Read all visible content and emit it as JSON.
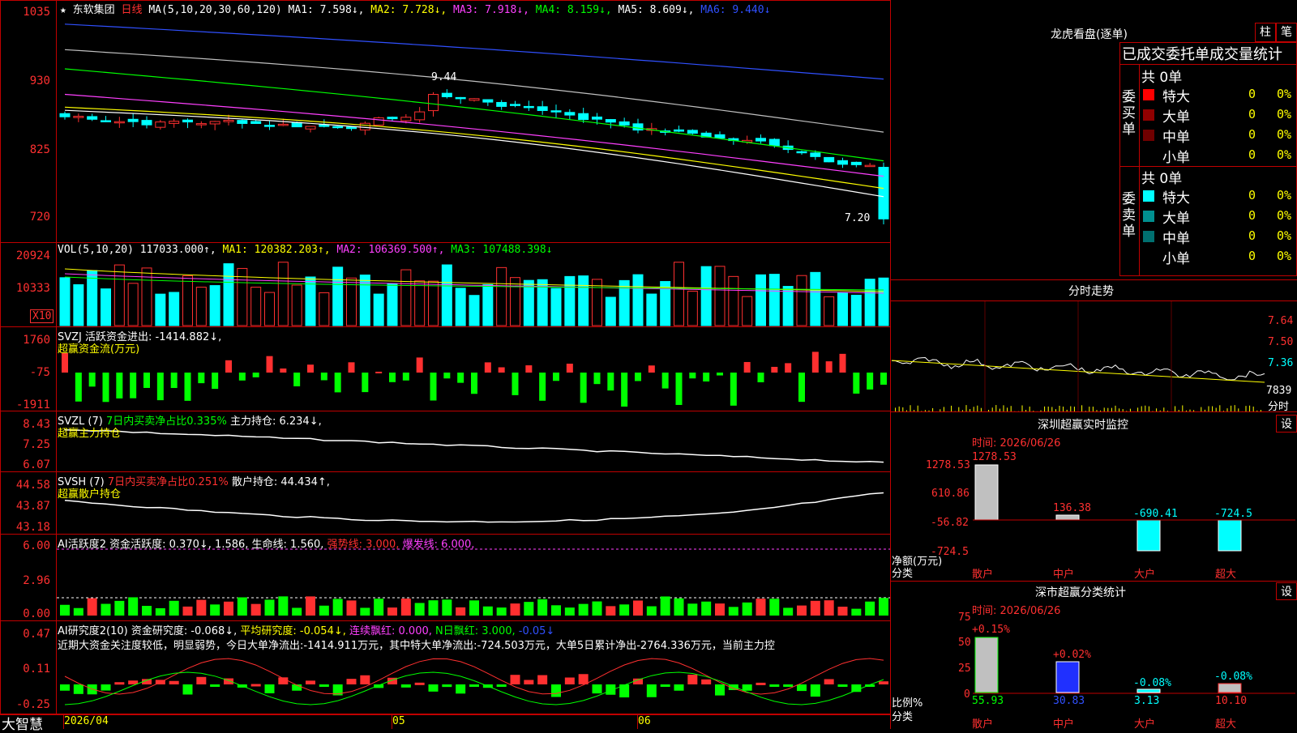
{
  "main_chart": {
    "star": "★",
    "stock_name": "东软集团",
    "period": "日线",
    "ma_header": "MA(5,10,20,30,60,120)",
    "ma1": "MA1: 7.598↓,",
    "ma2": "MA2: 7.728↓,",
    "ma3": "MA3: 7.918↓,",
    "ma4": "MA4: 8.159↓,",
    "ma5": "MA5: 8.609↓,",
    "ma6": "MA6: 9.440↓",
    "y_ticks": [
      "1035",
      "930",
      "825",
      "720"
    ],
    "high_label": "9.44",
    "low_label": "7.20"
  },
  "vol_chart": {
    "header": "VOL(5,10,20)",
    "vol": "117033.000↑,",
    "ma1": "MA1: 120382.203↑,",
    "ma2": "MA2: 106369.500↑,",
    "ma3": "MA3: 107488.398↓",
    "y_ticks": [
      "20924",
      "10333"
    ],
    "unit": "X10"
  },
  "svzj": {
    "header": "SVZJ  活跃资金进出: -1414.882↓,",
    "sub": "超赢资金流(万元)",
    "y_ticks": [
      "1760",
      "-75",
      "-1911"
    ]
  },
  "svzl": {
    "header_a": "SVZL (7)",
    "header_b": "7日内买卖净占比0.335%",
    "header_c": "主力持仓: 6.234↓,",
    "sub": "超赢主力持仓",
    "y_ticks": [
      "8.43",
      "7.25",
      "6.07"
    ]
  },
  "svsh": {
    "header_a": "SVSH (7)",
    "header_b": "7日内买卖净占比0.251%",
    "header_c": "散户持仓: 44.434↑,",
    "sub": "超赢散户持仓",
    "y_ticks": [
      "44.58",
      "43.87",
      "43.18"
    ]
  },
  "ai_active": {
    "header_a": "AI活跃度2",
    "header_b": "资金活跃度: 0.370↓,",
    "header_c": "1.586,",
    "header_d": "生命线: 1.560,",
    "header_e": "强势线: 3.000,",
    "header_f": "爆发线: 6.000,",
    "y_ticks": [
      "6.00",
      "2.96",
      "0.00"
    ]
  },
  "ai_research": {
    "header_a": "AI研究度2(10)",
    "header_b": "资金研究度: -0.068↓,",
    "header_c": "平均研究度: -0.054↓,",
    "header_d": "连续飘红: 0.000,",
    "header_e": "N日飘红: 3.000,",
    "header_f": "-0.05↓",
    "comment": "近期大资金关注度较低，明显弱势，今日大单净流出:-1414.911万元，其中特大单净流出:-724.503万元，大单5日累计净出-2764.336万元，当前主力控",
    "y_ticks": [
      "0.47",
      "0.11",
      "-0.25"
    ]
  },
  "footer": {
    "brand": "大智慧",
    "dates": [
      "2026/04",
      "05",
      "06"
    ]
  },
  "right_panel": {
    "lhb_title": "龙虎看盘(逐单)",
    "btn_bar": "柱",
    "btn_pen": "笔",
    "order_title": "已成交委托单成交量统计",
    "buy_label": "委买单",
    "sell_label": "委卖单",
    "buy_total": "共 0单",
    "sell_total": "共 0单",
    "buy_rows": [
      {
        "name": "特大",
        "count": "0",
        "pct": "0%",
        "color": "#ff0000"
      },
      {
        "name": "大单",
        "count": "0",
        "pct": "0%",
        "color": "#900000"
      },
      {
        "name": "中单",
        "count": "0",
        "pct": "0%",
        "color": "#700000"
      },
      {
        "name": "小单",
        "count": "0",
        "pct": "0%",
        "color": "#000000"
      }
    ],
    "sell_rows": [
      {
        "name": "特大",
        "count": "0",
        "pct": "0%",
        "color": "#00ffff"
      },
      {
        "name": "大单",
        "count": "0",
        "pct": "0%",
        "color": "#009090"
      },
      {
        "name": "中单",
        "count": "0",
        "pct": "0%",
        "color": "#007070"
      },
      {
        "name": "小单",
        "count": "0",
        "pct": "0%",
        "color": "#000000"
      }
    ],
    "intraday_title": "分时走势",
    "intraday_ticks": [
      "7.64",
      "7.50",
      "7.36"
    ],
    "intraday_vol": "7839",
    "intraday_unit": "分时",
    "monitor_title": "深圳超赢实时监控",
    "settings_btn": "设",
    "monitor_time": "时间: 2026/06/26",
    "monitor_yticks": [
      "1278.53",
      "610.86",
      "-56.82",
      "-724.5"
    ],
    "monitor_axis": "净额(万元)",
    "monitor_axis2": "分类",
    "monitor_cats": [
      "散户",
      "中户",
      "大户",
      "超大"
    ],
    "monitor_values": [
      "1278.53",
      "136.38",
      "-690.41",
      "-724.5"
    ],
    "class_title": "深市超赢分类统计",
    "class_time": "时间: 2026/06/26",
    "class_yticks": [
      "75",
      "50",
      "25",
      "0"
    ],
    "class_axis": "比例%",
    "class_axis2": "分类",
    "class_cats": [
      "散户",
      "中户",
      "大户",
      "超大"
    ],
    "class_pcts": [
      "+0.15%",
      "+0.02%",
      "-0.08%",
      "-0.08%"
    ],
    "class_values": [
      "55.93",
      "30.83",
      "3.13",
      "10.10"
    ]
  },
  "chart_data": {
    "type": "candlestick",
    "title": "东软集团 日线",
    "ylim": [
      7.0,
      10.5
    ],
    "ma_values": {
      "MA1": 7.598,
      "MA2": 7.728,
      "MA3": 7.918,
      "MA4": 8.159,
      "MA5": 8.609,
      "MA6": 9.44
    },
    "high": 9.44,
    "low": 7.2,
    "colors": {
      "up": "#ff3030",
      "down": "#00ffff",
      "ma1": "#ffffff",
      "ma2": "#ffff00",
      "ma3": "#ff40ff",
      "ma4": "#00ff00",
      "ma5": "#c0c0c0",
      "ma6": "#3050ff"
    }
  }
}
